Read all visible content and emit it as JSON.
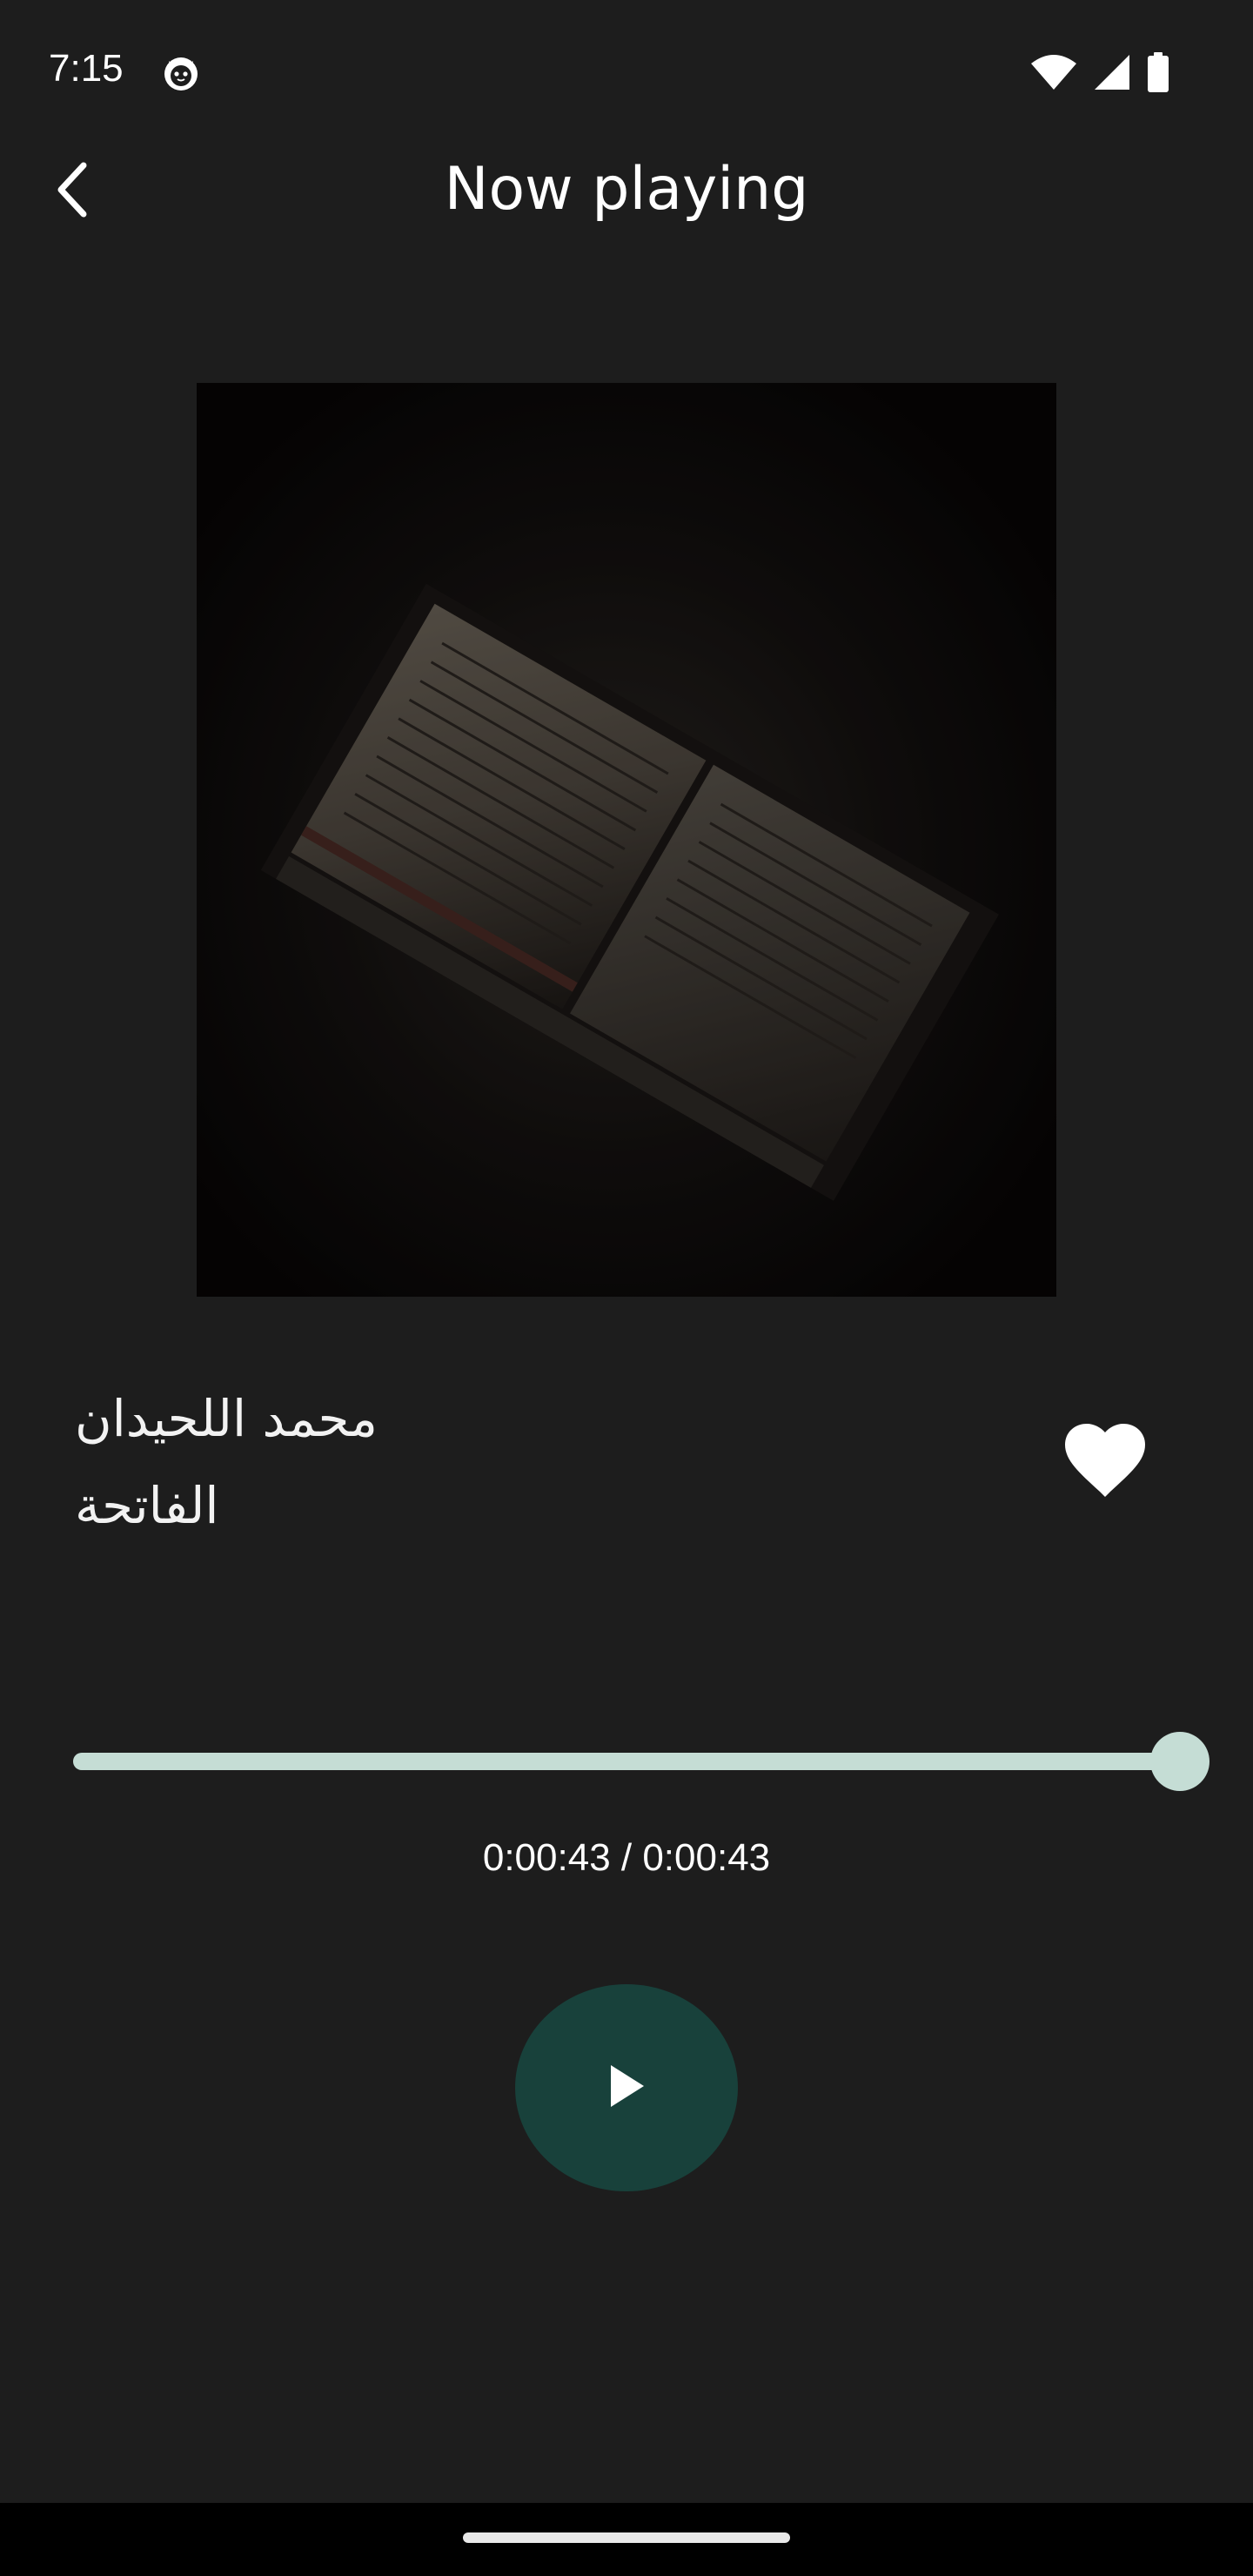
{
  "status_bar": {
    "time": "7:15",
    "notification_icon": "cat-face-icon",
    "icons": [
      "wifi-icon",
      "signal-icon",
      "battery-icon"
    ]
  },
  "app_bar": {
    "back_icon": "chevron-left-icon",
    "title": "Now playing"
  },
  "track": {
    "artist": "محمد اللحيدان",
    "title": "الفاتحة",
    "favorite_icon": "heart-icon",
    "favorited": true
  },
  "player": {
    "position": "0:00:43",
    "duration": "0:00:43",
    "time_text": "0:00:43 / 0:00:43",
    "progress": 1.0,
    "play_icon": "play-icon"
  },
  "colors": {
    "background": "#1d1d1d",
    "accent": "#c5ddd5",
    "play_button": "#18413b"
  }
}
